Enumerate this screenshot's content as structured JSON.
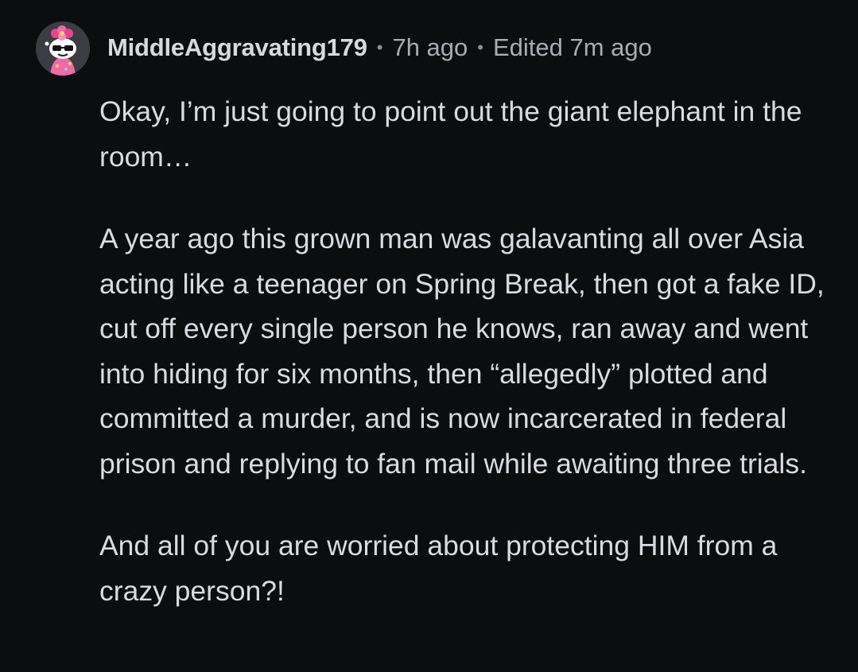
{
  "comment": {
    "author": "MiddleAggravating179",
    "posted": "7h ago",
    "edited": "Edited 7m ago",
    "separator": "•",
    "avatar_icon": "snoo-avatar-pink-flower-sunglasses",
    "paragraphs": [
      "Okay, I’m just going to point out the giant elephant in the room…",
      "A year ago this grown man was galavanting all over Asia acting like a teenager on Spring Break, then got a fake ID, cut off every single person he knows, ran away and went into hiding for six months, then “allegedly” plotted and committed a murder, and is now incarcerated in federal prison and replying to fan mail while awaiting three trials.",
      "And all of you are worried about protecting HIM from a crazy person?!"
    ]
  },
  "colors": {
    "background": "#0b0d0f",
    "text": "#d8dbe0",
    "muted": "#a8adb3"
  }
}
